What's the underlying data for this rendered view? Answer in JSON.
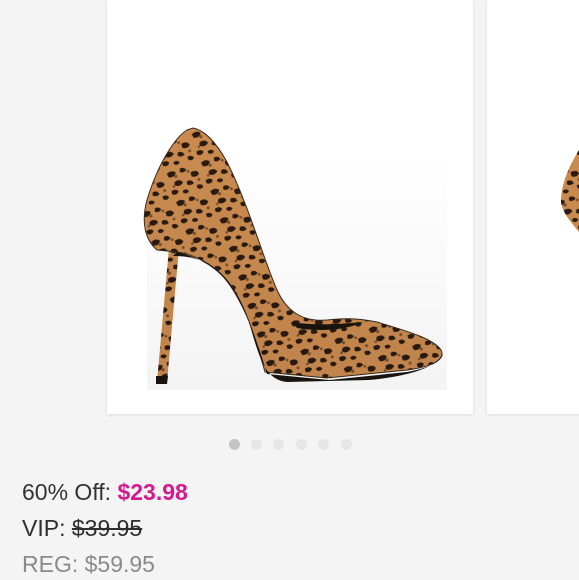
{
  "product": {
    "image_icon": "leopard-print-pointed-pump-icon",
    "carousel": {
      "slide_count": 6,
      "active_index": 0
    }
  },
  "pricing": {
    "sale_label": "60% Off:",
    "sale_price": "$23.98",
    "vip_label": "VIP:",
    "vip_price": "$39.95",
    "reg_label": "REG: $59.95"
  },
  "colors": {
    "sale_accent": "#d4198f",
    "background": "#f4f4f4",
    "dot_active": "#c4c4c4",
    "dot_inactive": "#e6e6e6"
  }
}
